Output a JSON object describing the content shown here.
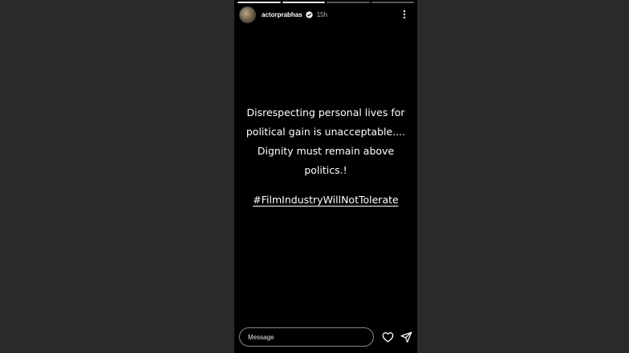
{
  "story": {
    "username": "actorprabhas",
    "verified": true,
    "time": "15h",
    "progress_segments": [
      1,
      1,
      0,
      0
    ],
    "text_lines": [
      "Disrespecting personal lives for",
      "political gain is unacceptable....",
      "Dignity must remain above",
      "politics.!"
    ],
    "hashtag": "#FilmIndustryWillNotTolerate"
  },
  "footer": {
    "message_placeholder": "Message"
  },
  "icons": {
    "avatar": "avatar",
    "verified": "verified-badge-icon",
    "more": "more-vertical-icon",
    "like": "heart-icon",
    "send": "send-icon"
  },
  "colors": {
    "backdrop": "#2a2a2d",
    "story_bg": "#000000",
    "text": "#ffffff"
  }
}
